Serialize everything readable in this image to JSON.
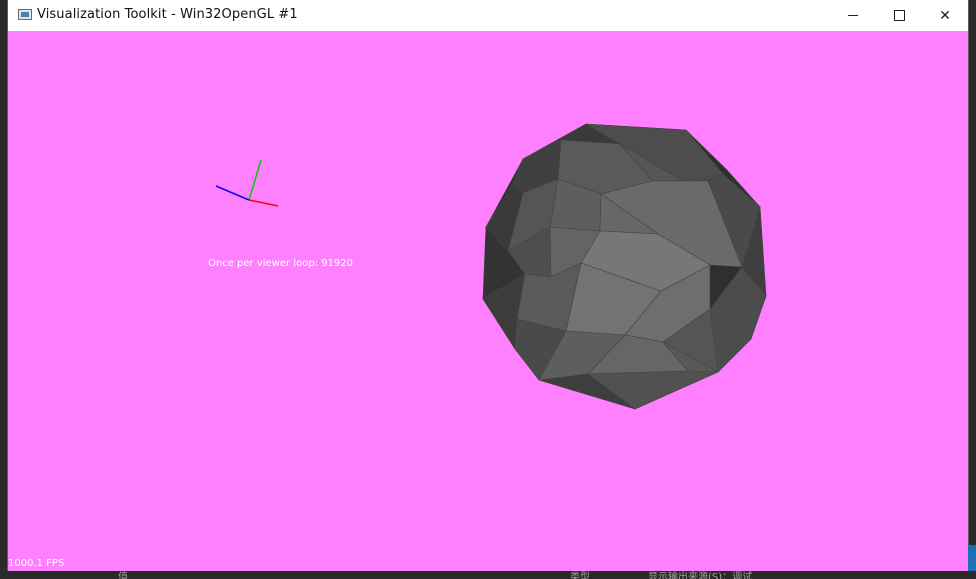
{
  "window": {
    "title": "Visualization Toolkit - Win32OpenGL #1",
    "controls": {
      "minimize_icon": "minimize-icon",
      "maximize_icon": "maximize-icon",
      "close_icon": "close-icon",
      "close_glyph": "✕"
    }
  },
  "viewport": {
    "background_color": "#ff80ff",
    "annotation_text": "Once per viewer loop: 91920",
    "fps_text": "1000.1 FPS",
    "axes_colors": {
      "x": "#ff0000",
      "y": "#00cc00",
      "z": "#0000ff"
    },
    "mesh_colors": [
      "#3a3a3a",
      "#4a4a4a",
      "#555555",
      "#5e5e5e",
      "#676767",
      "#6e6e6e",
      "#777777"
    ]
  },
  "taskbar": {
    "items": [
      "值",
      "类型",
      "显示输出来源(S)：调试"
    ]
  }
}
